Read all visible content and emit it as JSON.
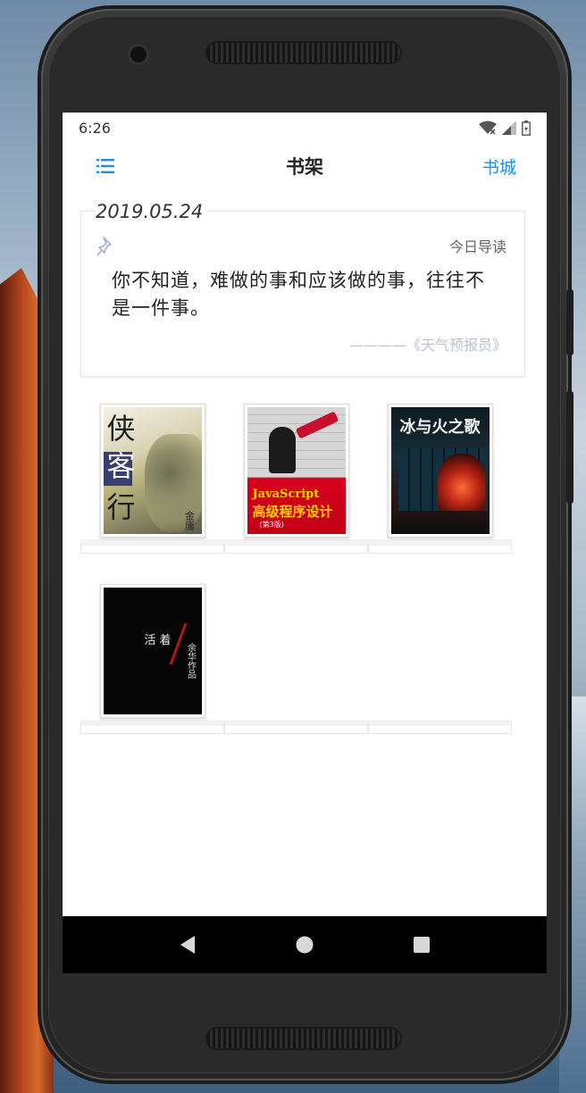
{
  "status_bar": {
    "time": "6:26"
  },
  "navbar": {
    "title": "书架",
    "store_label": "书城"
  },
  "daily_card": {
    "date": "2019.05.24",
    "tag": "今日导读",
    "quote": "你不知道，难做的事和应该做的事，往往不是一件事。",
    "source": "————《天气预报员》"
  },
  "books": [
    {
      "title": "侠客行",
      "cover_text": [
        "侠",
        "客",
        "行"
      ],
      "author": "金庸"
    },
    {
      "title": "JavaScript高级程序设计",
      "cover_text": [
        "JavaScript",
        "高级程序设计",
        "(第3版)"
      ]
    },
    {
      "title": "冰与火之歌",
      "cover_text": [
        "冰与火之歌"
      ]
    },
    {
      "title": "活着",
      "cover_text": [
        "活着",
        "余华作品"
      ]
    }
  ],
  "colors": {
    "accent": "#1a8fe3",
    "background": "#ffffff",
    "source_text": "#b8c3cf"
  },
  "icons": {
    "menu": "menu-list-icon",
    "pin": "pin-icon",
    "back": "back-triangle-icon",
    "home": "home-circle-icon",
    "recents": "recents-square-icon"
  }
}
